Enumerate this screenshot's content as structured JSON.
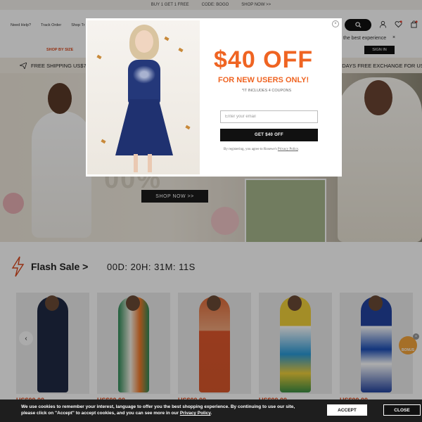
{
  "promo": {
    "left": "BUY 1 GET 1 FREE",
    "code": "CODE: BOGO",
    "cta": "SHOP NOW >>"
  },
  "header": {
    "links": [
      "Need Help?",
      "Track Order",
      "Shop Tr"
    ],
    "icons": [
      "search-icon",
      "user-icon",
      "heart-icon",
      "bag-icon"
    ]
  },
  "subheader": {
    "shop_by": "SHOP BY SIZE",
    "best_exp": "the best experience",
    "close": "×",
    "signin": "SIGN IN"
  },
  "shipping": {
    "left": "FREE SHIPPING US$79+",
    "right": "0 DAYS FREE EXCHANGE FOR US I"
  },
  "hero": {
    "big_text": "00%",
    "shop_now": "SHOP NOW >>"
  },
  "flash": {
    "title": "Flash Sale >",
    "timer": "00D: 20H: 31M: 11S",
    "prices": [
      "US$00.00",
      "US$00.00",
      "US$00.00",
      "US$00.00",
      "US$00.00"
    ],
    "bonus": "BONUS"
  },
  "cookie": {
    "text": "We use cookies to remember your interest, language to offer you the best shopping experience. By continuing to use our site, please click on \"Accept\" to accept cookies, and you can see more in our",
    "link": "Privacy Policy",
    "end": ".",
    "accept": "ACCEPT",
    "close": "CLOSE"
  },
  "modal": {
    "headline": "$40 OFF",
    "sub": "FOR NEW USERS ONLY!",
    "coupons": "*IT INCLUDES 4 COUPONS",
    "email_placeholder": "Enter your email",
    "button": "GET $40 OFF",
    "terms_prefix": "By registering, you agree to Rosewe's",
    "terms_link": "Privacy Policy",
    "terms_end": "."
  },
  "colors": {
    "accent": "#ef6422",
    "dark": "#111111",
    "price": "#d9481d"
  }
}
